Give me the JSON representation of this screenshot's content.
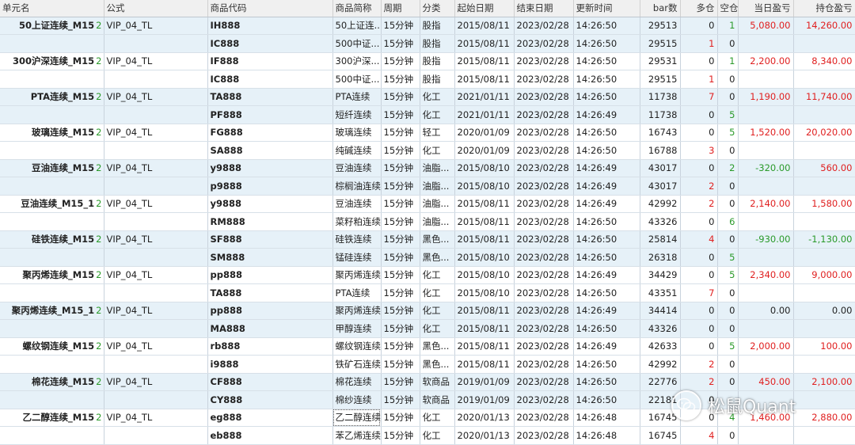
{
  "columns": [
    "单元名",
    "公式",
    "商品代码",
    "商品简称",
    "周期",
    "分类",
    "起始日期",
    "结束日期",
    "更新时间",
    "bar数",
    "多仓",
    "空仓",
    "当日盈亏",
    "持仓盈亏"
  ],
  "colors": {
    "positive": "#e02020",
    "negative": "#2a9a2a",
    "header_bg": "#f0f0f0",
    "row_bg": "#e6f1f8"
  },
  "rows": [
    {
      "unit": "50上证连续_M15",
      "suffix": "2",
      "formula": "VIP_04_TL",
      "code": "IH888",
      "name": "50上证连...",
      "period": "15分钟",
      "category": "股指",
      "start": "2015/08/11",
      "end": "2023/02/28",
      "update": "14:26:50",
      "bars": "29513",
      "long": "0",
      "short": "1",
      "daily": "5,080.00",
      "hold": "14,260.00"
    },
    {
      "unit": "",
      "suffix": "",
      "formula": "",
      "code": "IC888",
      "name": "500中证...",
      "period": "15分钟",
      "category": "股指",
      "start": "2015/08/11",
      "end": "2023/02/28",
      "update": "14:26:50",
      "bars": "29515",
      "long": "1",
      "short": "0",
      "daily": "",
      "hold": ""
    },
    {
      "unit": "300沪深连续_M15",
      "suffix": "2",
      "formula": "VIP_04_TL",
      "code": "IF888",
      "name": "300沪深...",
      "period": "15分钟",
      "category": "股指",
      "start": "2015/08/11",
      "end": "2023/02/28",
      "update": "14:26:50",
      "bars": "29531",
      "long": "0",
      "short": "1",
      "daily": "2,200.00",
      "hold": "8,340.00"
    },
    {
      "unit": "",
      "suffix": "",
      "formula": "",
      "code": "IC888",
      "name": "500中证...",
      "period": "15分钟",
      "category": "股指",
      "start": "2015/08/11",
      "end": "2023/02/28",
      "update": "14:26:50",
      "bars": "29515",
      "long": "1",
      "short": "0",
      "daily": "",
      "hold": ""
    },
    {
      "unit": "PTA连续_M15",
      "suffix": "2",
      "formula": "VIP_04_TL",
      "code": "TA888",
      "name": "PTA连续",
      "period": "15分钟",
      "category": "化工",
      "start": "2021/01/11",
      "end": "2023/02/28",
      "update": "14:26:50",
      "bars": "11738",
      "long": "7",
      "short": "0",
      "daily": "1,190.00",
      "hold": "11,740.00"
    },
    {
      "unit": "",
      "suffix": "",
      "formula": "",
      "code": "PF888",
      "name": "短纤连续",
      "period": "15分钟",
      "category": "化工",
      "start": "2021/01/11",
      "end": "2023/02/28",
      "update": "14:26:49",
      "bars": "11738",
      "long": "0",
      "short": "5",
      "daily": "",
      "hold": ""
    },
    {
      "unit": "玻璃连续_M15",
      "suffix": "2",
      "formula": "VIP_04_TL",
      "code": "FG888",
      "name": "玻璃连续",
      "period": "15分钟",
      "category": "轻工",
      "start": "2020/01/09",
      "end": "2023/02/28",
      "update": "14:26:50",
      "bars": "16743",
      "long": "0",
      "short": "5",
      "daily": "1,520.00",
      "hold": "20,020.00"
    },
    {
      "unit": "",
      "suffix": "",
      "formula": "",
      "code": "SA888",
      "name": "纯碱连续",
      "period": "15分钟",
      "category": "化工",
      "start": "2020/01/09",
      "end": "2023/02/28",
      "update": "14:26:50",
      "bars": "16788",
      "long": "3",
      "short": "0",
      "daily": "",
      "hold": ""
    },
    {
      "unit": "豆油连续_M15",
      "suffix": "2",
      "formula": "VIP_04_TL",
      "code": "y9888",
      "name": "豆油连续",
      "period": "15分钟",
      "category": "油脂...",
      "start": "2015/08/10",
      "end": "2023/02/28",
      "update": "14:26:49",
      "bars": "43017",
      "long": "0",
      "short": "2",
      "daily": "-320.00",
      "hold": "560.00"
    },
    {
      "unit": "",
      "suffix": "",
      "formula": "",
      "code": "p9888",
      "name": "棕榈油连续",
      "period": "15分钟",
      "category": "油脂...",
      "start": "2015/08/10",
      "end": "2023/02/28",
      "update": "14:26:49",
      "bars": "43017",
      "long": "2",
      "short": "0",
      "daily": "",
      "hold": ""
    },
    {
      "unit": "豆油连续_M15_1",
      "suffix": "2",
      "formula": "VIP_04_TL",
      "code": "y9888",
      "name": "豆油连续",
      "period": "15分钟",
      "category": "油脂...",
      "start": "2015/08/11",
      "end": "2023/02/28",
      "update": "14:26:49",
      "bars": "42992",
      "long": "2",
      "short": "0",
      "daily": "2,140.00",
      "hold": "1,580.00"
    },
    {
      "unit": "",
      "suffix": "",
      "formula": "",
      "code": "RM888",
      "name": "菜籽粕连续",
      "period": "15分钟",
      "category": "油脂...",
      "start": "2015/08/11",
      "end": "2023/02/28",
      "update": "14:26:50",
      "bars": "43326",
      "long": "0",
      "short": "6",
      "daily": "",
      "hold": ""
    },
    {
      "unit": "硅铁连续_M15",
      "suffix": "2",
      "formula": "VIP_04_TL",
      "code": "SF888",
      "name": "硅铁连续",
      "period": "15分钟",
      "category": "黑色...",
      "start": "2015/08/11",
      "end": "2023/02/28",
      "update": "14:26:50",
      "bars": "25814",
      "long": "4",
      "short": "0",
      "daily": "-930.00",
      "hold": "-1,130.00"
    },
    {
      "unit": "",
      "suffix": "",
      "formula": "",
      "code": "SM888",
      "name": "锰硅连续",
      "period": "15分钟",
      "category": "黑色...",
      "start": "2015/08/10",
      "end": "2023/02/28",
      "update": "14:26:50",
      "bars": "26318",
      "long": "0",
      "short": "5",
      "daily": "",
      "hold": ""
    },
    {
      "unit": "聚丙烯连续_M15",
      "suffix": "2",
      "formula": "VIP_04_TL",
      "code": "pp888",
      "name": "聚丙烯连续",
      "period": "15分钟",
      "category": "化工",
      "start": "2015/08/10",
      "end": "2023/02/28",
      "update": "14:26:49",
      "bars": "34429",
      "long": "0",
      "short": "5",
      "daily": "2,340.00",
      "hold": "9,000.00"
    },
    {
      "unit": "",
      "suffix": "",
      "formula": "",
      "code": "TA888",
      "name": "PTA连续",
      "period": "15分钟",
      "category": "化工",
      "start": "2015/08/10",
      "end": "2023/02/28",
      "update": "14:26:50",
      "bars": "43351",
      "long": "7",
      "short": "0",
      "daily": "",
      "hold": ""
    },
    {
      "unit": "聚丙烯连续_M15_1",
      "suffix": "2",
      "formula": "VIP_04_TL",
      "code": "pp888",
      "name": "聚丙烯连续",
      "period": "15分钟",
      "category": "化工",
      "start": "2015/08/11",
      "end": "2023/02/28",
      "update": "14:26:49",
      "bars": "34414",
      "long": "0",
      "short": "0",
      "daily": "0.00",
      "hold": "0.00"
    },
    {
      "unit": "",
      "suffix": "",
      "formula": "",
      "code": "MA888",
      "name": "甲醇连续",
      "period": "15分钟",
      "category": "化工",
      "start": "2015/08/11",
      "end": "2023/02/28",
      "update": "14:26:50",
      "bars": "43326",
      "long": "0",
      "short": "0",
      "daily": "",
      "hold": ""
    },
    {
      "unit": "螺纹钢连续_M15",
      "suffix": "2",
      "formula": "VIP_04_TL",
      "code": "rb888",
      "name": "螺纹钢连续",
      "period": "15分钟",
      "category": "黑色...",
      "start": "2015/08/11",
      "end": "2023/02/28",
      "update": "14:26:49",
      "bars": "42633",
      "long": "0",
      "short": "5",
      "daily": "2,000.00",
      "hold": "100.00"
    },
    {
      "unit": "",
      "suffix": "",
      "formula": "",
      "code": "i9888",
      "name": "铁矿石连续",
      "period": "15分钟",
      "category": "黑色...",
      "start": "2015/08/11",
      "end": "2023/02/28",
      "update": "14:26:50",
      "bars": "42992",
      "long": "2",
      "short": "0",
      "daily": "",
      "hold": ""
    },
    {
      "unit": "棉花连续_M15",
      "suffix": "2",
      "formula": "VIP_04_TL",
      "code": "CF888",
      "name": "棉花连续",
      "period": "15分钟",
      "category": "软商品",
      "start": "2019/01/09",
      "end": "2023/02/28",
      "update": "14:26:50",
      "bars": "22776",
      "long": "2",
      "short": "0",
      "daily": "450.00",
      "hold": "2,100.00"
    },
    {
      "unit": "",
      "suffix": "",
      "formula": "",
      "code": "CY888",
      "name": "棉纱连续",
      "period": "15分钟",
      "category": "软商品",
      "start": "2019/01/09",
      "end": "2023/02/28",
      "update": "14:26:50",
      "bars": "22181",
      "long": "0",
      "short": "",
      "daily": "",
      "hold": ""
    },
    {
      "unit": "乙二醇连续_M15",
      "suffix": "2",
      "formula": "VIP_04_TL",
      "code": "eg888",
      "name": "乙二醇连续",
      "period": "15分钟",
      "category": "化工",
      "start": "2020/01/13",
      "end": "2023/02/28",
      "update": "14:26:48",
      "bars": "16745",
      "long": "0",
      "short": "4",
      "daily": "1,460.00",
      "hold": "2,880.00"
    },
    {
      "unit": "",
      "suffix": "",
      "formula": "",
      "code": "eb888",
      "name": "苯乙烯连续",
      "period": "15分钟",
      "category": "化工",
      "start": "2020/01/13",
      "end": "2023/02/28",
      "update": "14:26:48",
      "bars": "16745",
      "long": "4",
      "short": "0",
      "daily": "",
      "hold": ""
    }
  ],
  "watermark": {
    "text": "松鼠Quant",
    "icon": "wechat-icon"
  }
}
